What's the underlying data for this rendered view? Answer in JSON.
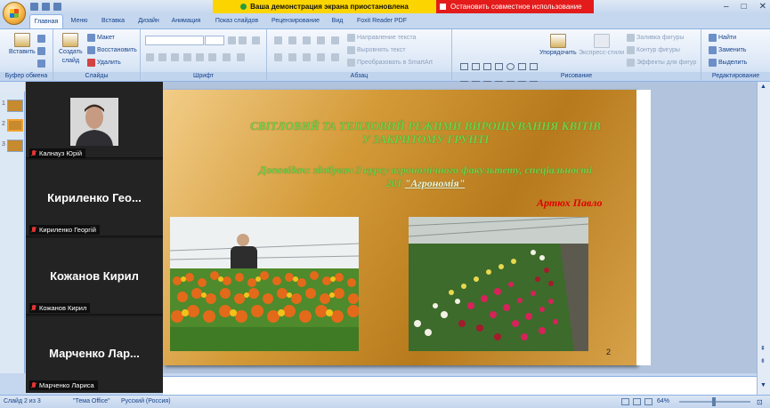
{
  "share_banner": {
    "paused": "Ваша демонстрация экрана приостановлена",
    "stop": "Остановить совместное использование"
  },
  "tabs": [
    "Главная",
    "Меню",
    "Вставка",
    "Дизайн",
    "Анимация",
    "Показ слайдов",
    "Рецензирование",
    "Вид",
    "Foxit Reader PDF"
  ],
  "ribbon": {
    "clipboard": {
      "paste": "Вставить",
      "group": "Буфер обмена"
    },
    "slides": {
      "create": "Создать",
      "create2": "слайд",
      "layout": "Макет",
      "reset": "Восстановить",
      "delete": "Удалить",
      "group": "Слайды"
    },
    "font": {
      "group": "Шрифт"
    },
    "paragraph": {
      "direction": "Направление текста",
      "align": "Выровнять текст",
      "smartart": "Преобразовать в SmartArt",
      "group": "Абзац"
    },
    "drawing": {
      "arrange": "Упорядочить",
      "styles": "Экспресс-стили",
      "fill": "Заливка фигуры",
      "outline": "Контур фигуры",
      "effects": "Эффекты для фигур",
      "group": "Рисование"
    },
    "editing": {
      "find": "Найти",
      "replace": "Заменить",
      "select": "Выделить",
      "group": "Редактирование"
    }
  },
  "thumb_numbers": [
    "1",
    "2",
    "3"
  ],
  "participants": [
    {
      "name_short": "",
      "tag": "Калнауз Юрій",
      "has_video": true
    },
    {
      "name_short": "Кириленко  Гео...",
      "tag": "Кириленко Георгій",
      "has_video": false
    },
    {
      "name_short": "Кожанов Кирил",
      "tag": "Кожанов Кирил",
      "has_video": false
    },
    {
      "name_short": "Марченко  Лар...",
      "tag": "Марченко Лариса",
      "has_video": false
    }
  ],
  "slide": {
    "title_line1": "СВІТЛОВИЙ ТА  ТЕПЛОВИЙ РЕЖИМИ  ВИРОЩУВАННЯ  КВІТІВ",
    "title_line2": "У ЗАКРИТОМУ ГРУНТІ",
    "sub_line1": "Доповідач: здобувач 3 курсу агрономічного факультету, спеціальності",
    "sub_line2": "201 ",
    "sub_link": "\"Агрономія\"",
    "author": "Артюх Павло",
    "number": "2"
  },
  "status": {
    "slide": "Слайд 2 из 3",
    "theme": "\"Тема Office\"",
    "lang": "Русский (Россия)",
    "zoom": "64%"
  },
  "colors": {
    "slide_title": "#6fd14a",
    "author": "#e00000",
    "share_paused": "#fcd500",
    "share_stop": "#e31b1b"
  }
}
